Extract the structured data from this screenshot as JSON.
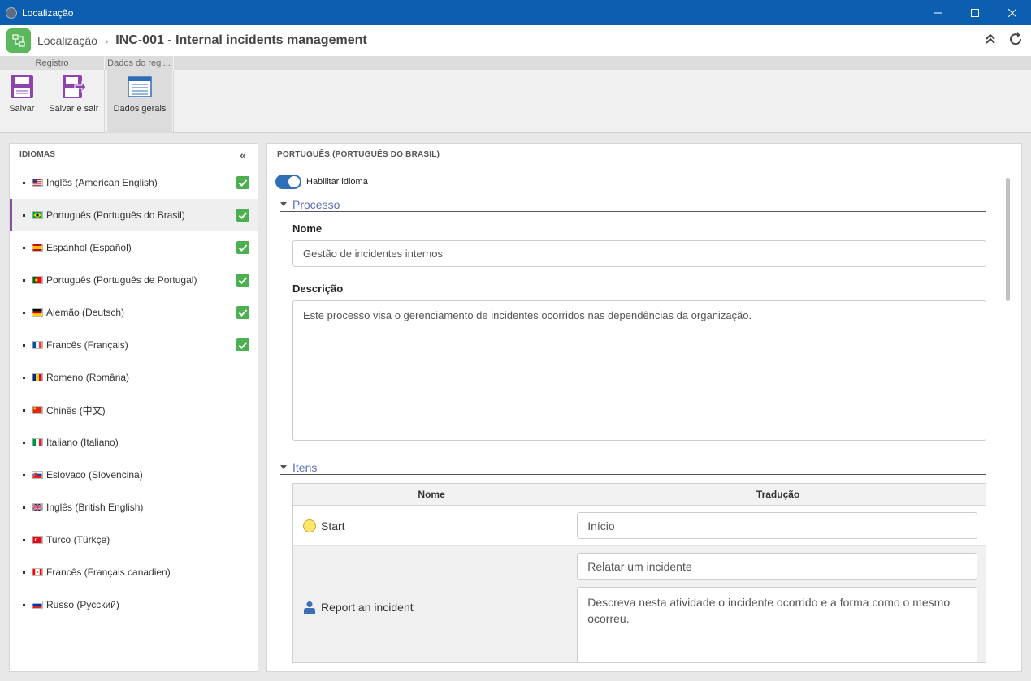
{
  "window": {
    "title": "Localização"
  },
  "header": {
    "root": "Localização",
    "page": "INC-001 - Internal incidents management"
  },
  "ribbon": {
    "tabs": [
      "Registro",
      "Dados do regi..."
    ],
    "buttons": {
      "save": "Salvar",
      "save_exit": "Salvar e sair",
      "general": "Dados gerais"
    }
  },
  "languages": {
    "header": "IDIOMAS",
    "items": [
      {
        "label": "Inglês (American English)",
        "flag": "us",
        "checked": true
      },
      {
        "label": "Português (Português do Brasil)",
        "flag": "br",
        "checked": true,
        "active": true
      },
      {
        "label": "Espanhol (Español)",
        "flag": "es",
        "checked": true
      },
      {
        "label": "Português (Português de Portugal)",
        "flag": "pt",
        "checked": true
      },
      {
        "label": "Alemão (Deutsch)",
        "flag": "de",
        "checked": true
      },
      {
        "label": "Francês (Français)",
        "flag": "fr",
        "checked": true
      },
      {
        "label": "Romeno (Româna)",
        "flag": "ro",
        "checked": false
      },
      {
        "label": "Chinês (中文)",
        "flag": "cn",
        "checked": false
      },
      {
        "label": "Italiano (Italiano)",
        "flag": "it",
        "checked": false
      },
      {
        "label": "Eslovaco (Slovencina)",
        "flag": "sk",
        "checked": false
      },
      {
        "label": "Inglês (British English)",
        "flag": "gb",
        "checked": false
      },
      {
        "label": "Turco (Türkçe)",
        "flag": "tr",
        "checked": false
      },
      {
        "label": "Francês (Français canadien)",
        "flag": "ca",
        "checked": false
      },
      {
        "label": "Russo (Русский)",
        "flag": "ru",
        "checked": false
      }
    ]
  },
  "detail": {
    "header": "PORTUGUÊS (PORTUGUÊS DO BRASIL)",
    "toggle_label": "Habilitar idioma",
    "process_section": "Processo",
    "name_label": "Nome",
    "name_value": "Gestão de incidentes internos",
    "desc_label": "Descrição",
    "desc_value": "Este processo visa o gerenciamento de incidentes ocorridos nas dependências da organização.",
    "items_section": "Itens",
    "grid": {
      "col_name": "Nome",
      "col_translation": "Tradução",
      "rows": [
        {
          "name": "Start",
          "translation": "Início"
        },
        {
          "name": "Report an incident",
          "translation": "Relatar um incidente",
          "description": "Descreva nesta atividade o incidente ocorrido e a forma como o mesmo ocorreu."
        }
      ]
    }
  }
}
